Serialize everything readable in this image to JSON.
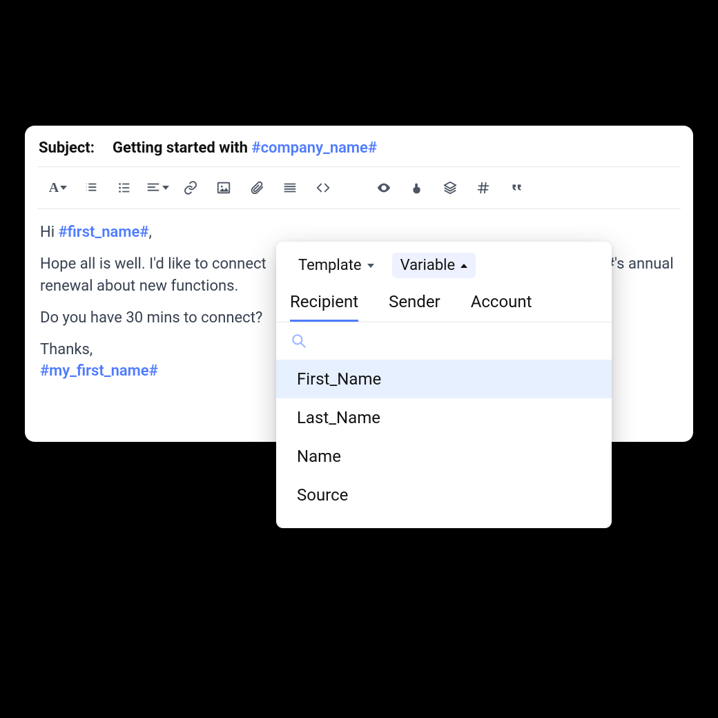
{
  "subject": {
    "label": "Subject:",
    "prefix": "Getting started with ",
    "token": "#company_name#"
  },
  "body": {
    "greeting_prefix": "Hi ",
    "greeting_token": "#first_name#",
    "greeting_suffix": ",",
    "p1_a": "Hope all is well. I'd like to connect",
    "p1_b": "#'s annual renewal about new functions.",
    "p2": "Do you have 30 mins to connect?",
    "thanks": "Thanks,",
    "sig_token": "#my_first_name#"
  },
  "popover": {
    "template_label": "Template",
    "variable_label": "Variable",
    "tabs": [
      "Recipient",
      "Sender",
      "Account"
    ],
    "items": [
      "First_Name",
      "Last_Name",
      "Name",
      "Source"
    ]
  }
}
